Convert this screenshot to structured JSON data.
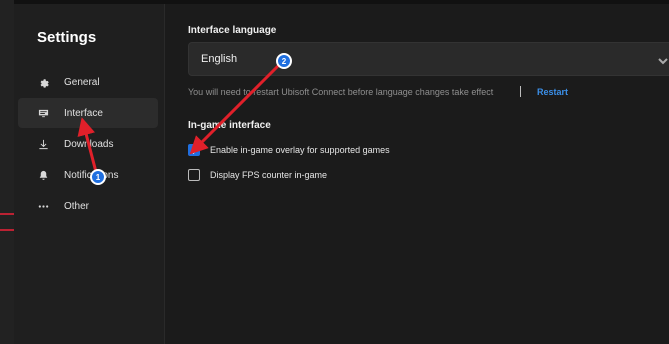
{
  "sidebar": {
    "title": "Settings",
    "items": [
      {
        "label": "General",
        "icon": "gear-icon",
        "active": false
      },
      {
        "label": "Interface",
        "icon": "display-icon",
        "active": true
      },
      {
        "label": "Downloads",
        "icon": "download-icon",
        "active": false
      },
      {
        "label": "Notifications",
        "icon": "bell-icon",
        "active": false
      },
      {
        "label": "Other",
        "icon": "ellipsis-icon",
        "active": false
      }
    ]
  },
  "main": {
    "language_label": "Interface language",
    "language_value": "English",
    "restart_note": "You will need to restart Ubisoft Connect before language changes take effect",
    "restart_link": "Restart",
    "ingame_label": "In-game interface",
    "options": [
      {
        "label": "Enable in-game overlay for supported games",
        "checked": true
      },
      {
        "label": "Display FPS counter in-game",
        "checked": false
      }
    ]
  },
  "annotations": {
    "marker_1": "1",
    "marker_2": "2",
    "arrow_color": "#e0202a"
  },
  "colors": {
    "accent": "#1f6fe0",
    "link": "#3b8fe8",
    "background": "#1b1b1b"
  }
}
